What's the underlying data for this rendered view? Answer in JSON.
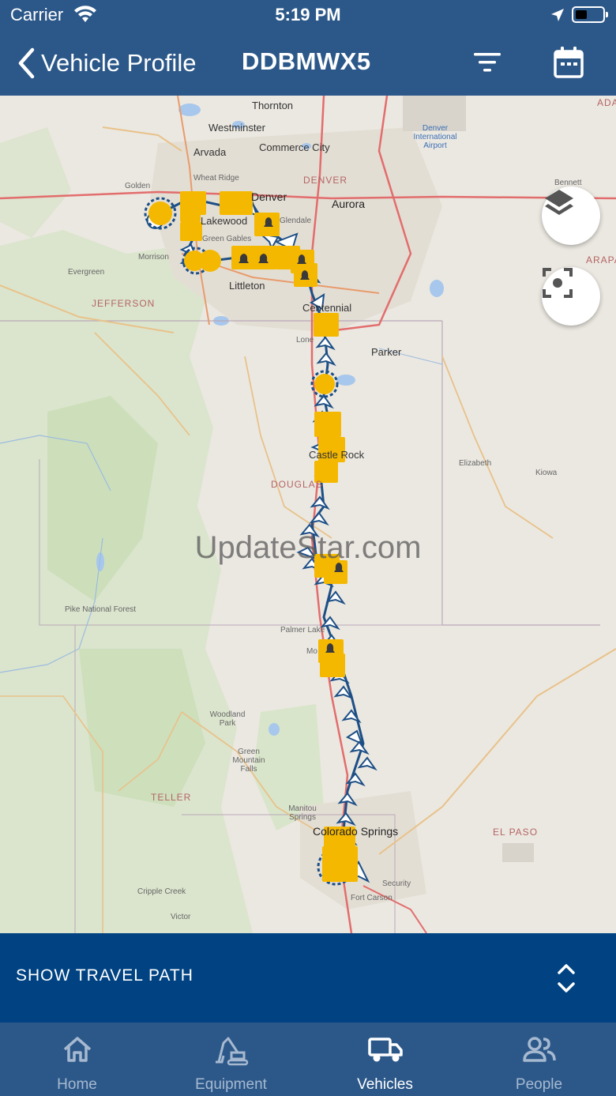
{
  "status_bar": {
    "carrier": "Carrier",
    "time": "5:19 PM"
  },
  "header": {
    "back_label": "Vehicle Profile",
    "title": "DDBMWX5"
  },
  "map": {
    "watermark": "UpdateStar.com",
    "labels": {
      "thornton": "Thornton",
      "westminster": "Westminster",
      "arvada": "Arvada",
      "commerce_city": "Commerce City",
      "denver_caps": "DENVER",
      "denver_airport": "Denver International Airport",
      "wheat_ridge": "Wheat Ridge",
      "golden": "Golden",
      "denver": "Denver",
      "aurora": "Aurora",
      "glendale": "Glendale",
      "lakewood": "Lakewood",
      "green_gables": "Green Gables",
      "morrison": "Morrison",
      "evergreen": "Evergreen",
      "littleton": "Littleton",
      "centennial": "Centennial",
      "jefferson": "JEFFERSON",
      "lone_tree": "Lone",
      "parker": "Parker",
      "castle_rock": "Castle Rock",
      "douglas": "DOUGLAS",
      "elizabeth": "Elizabeth",
      "kiowa": "Kiowa",
      "pike_forest": "Pike National Forest",
      "palmer_lake": "Palmer Lake",
      "woodland_park": "Woodland Park",
      "green_mountain_falls": "Green Mountain Falls",
      "teller": "TELLER",
      "manitou_springs": "Manitou Springs",
      "colorado_springs": "Colorado Springs",
      "el_paso": "EL PASO",
      "security": "Security",
      "fort_carson": "Fort Carson",
      "cripple_creek": "Cripple Creek",
      "victor": "Victor",
      "bennett": "Bennett",
      "ada": "ADA",
      "arapa": "ARAPA",
      "monument": "Mo"
    }
  },
  "travel_bar": {
    "label": "SHOW TRAVEL PATH"
  },
  "tabs": [
    {
      "label": "Home",
      "icon": "home-icon"
    },
    {
      "label": "Equipment",
      "icon": "excavator-icon"
    },
    {
      "label": "Vehicles",
      "icon": "truck-icon"
    },
    {
      "label": "People",
      "icon": "people-icon"
    }
  ],
  "colors": {
    "header_bg": "#2c5889",
    "travel_bar_bg": "#014382",
    "marker_yellow": "#f5b800",
    "path_blue": "#1d4f86"
  }
}
